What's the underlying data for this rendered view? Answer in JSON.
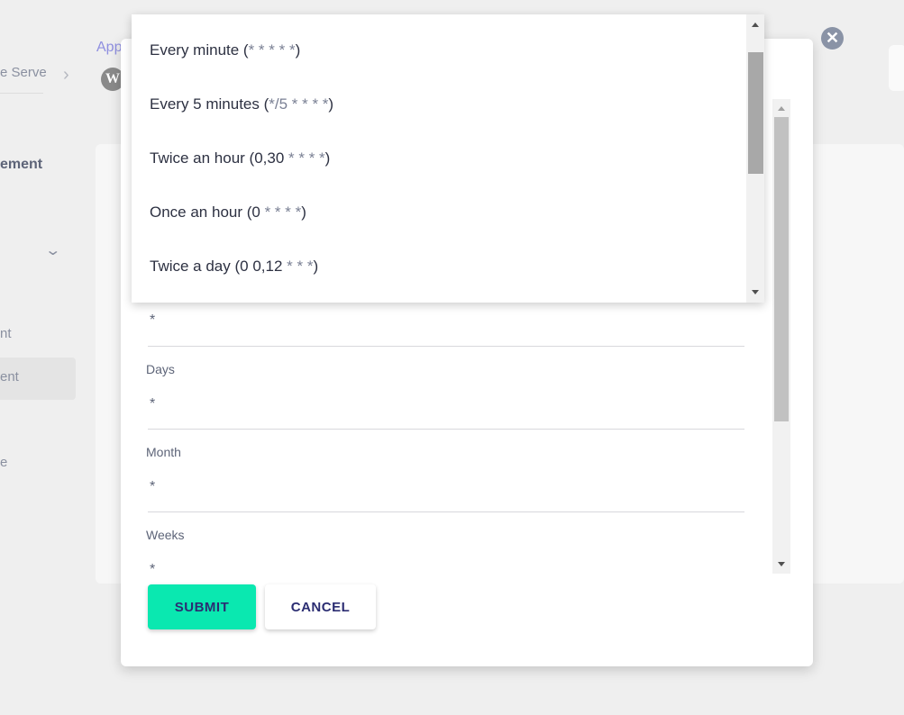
{
  "background": {
    "sidebar": {
      "server_label": "e Serve",
      "section_title": "ement",
      "item_1": "nt",
      "item_active": "ent",
      "item_3": "e"
    },
    "breadcrumb": {
      "app_link": "App"
    }
  },
  "modal": {
    "fields": [
      {
        "label": "",
        "value": "*"
      },
      {
        "label": "Days",
        "value": "*"
      },
      {
        "label": "Month",
        "value": "*"
      },
      {
        "label": "Weeks",
        "value": "*"
      }
    ],
    "submit_label": "SUBMIT",
    "cancel_label": "CANCEL",
    "close_icon": "close-icon"
  },
  "dropdown": {
    "options": [
      {
        "label": "Every minute (",
        "cron": "* * * * *",
        "end": ")"
      },
      {
        "label": "Every 5 minutes (",
        "cron": "*/5 * * * *",
        "end": ")"
      },
      {
        "label": "Twice an hour (0,30 ",
        "cron": "* * * *",
        "end": ")"
      },
      {
        "label": "Once an hour (0 ",
        "cron": "* * * *",
        "end": ")"
      },
      {
        "label": "Twice a day (0 0,12 ",
        "cron": "* * *",
        "end": ")"
      }
    ]
  },
  "colors": {
    "submit": "#0ae8b0",
    "button_text": "#2b2d72",
    "close": "#8a93a6"
  }
}
